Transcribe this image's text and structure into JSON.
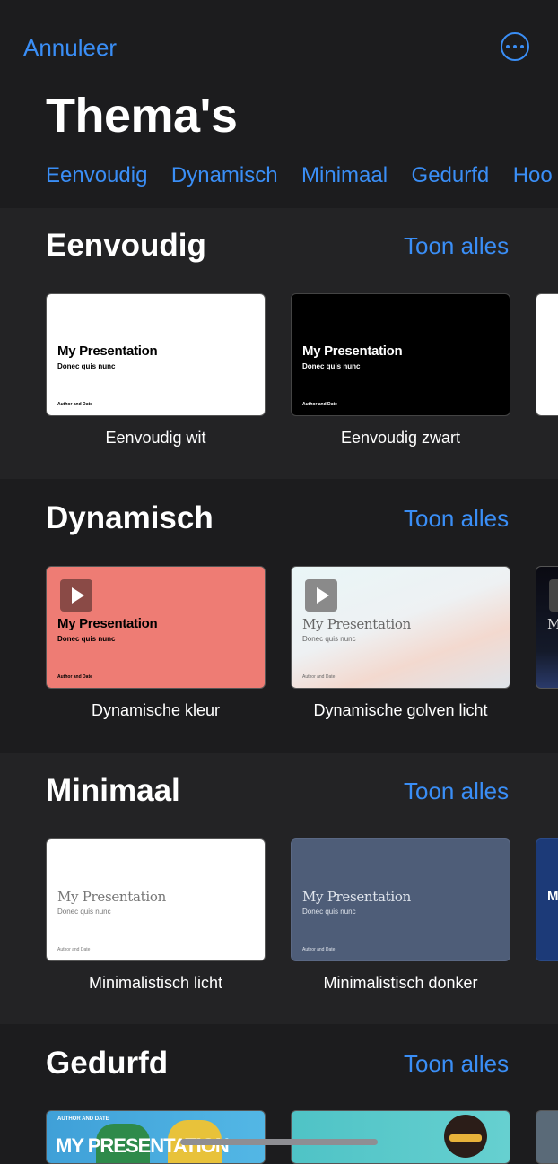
{
  "header": {
    "cancel_label": "Annuleer",
    "more_icon": "ellipsis-circle-icon"
  },
  "title": "Thema's",
  "tabs": [
    "Eenvoudig",
    "Dynamisch",
    "Minimaal",
    "Gedurfd",
    "Hoo"
  ],
  "sections": [
    {
      "title": "Eenvoudig",
      "show_all": "Toon alles",
      "themes": [
        {
          "name": "Eenvoudig wit",
          "slide_title": "My Presentation",
          "slide_subtitle": "Donec quis nunc",
          "slide_footer": "Author and Date"
        },
        {
          "name": "Eenvoudig zwart",
          "slide_title": "My Presentation",
          "slide_subtitle": "Donec quis nunc",
          "slide_footer": "Author and Date"
        }
      ]
    },
    {
      "title": "Dynamisch",
      "show_all": "Toon alles",
      "themes": [
        {
          "name": "Dynamische kleur",
          "slide_title": "My Presentation",
          "slide_subtitle": "Donec quis nunc",
          "slide_footer": "Author and Date"
        },
        {
          "name": "Dynamische golven licht",
          "slide_title": "My Presentation",
          "slide_subtitle": "Donec quis nunc",
          "slide_footer": "Author and Date"
        },
        {
          "slide_title": "M"
        }
      ]
    },
    {
      "title": "Minimaal",
      "show_all": "Toon alles",
      "themes": [
        {
          "name": "Minimalistisch licht",
          "slide_title": "My Presentation",
          "slide_subtitle": "Donec quis nunc",
          "slide_footer": "Author and Date"
        },
        {
          "name": "Minimalistisch donker",
          "slide_title": "My Presentation",
          "slide_subtitle": "Donec quis nunc",
          "slide_footer": "Author and Date"
        },
        {
          "slide_title": "M"
        }
      ]
    },
    {
      "title": "Gedurfd",
      "show_all": "Toon alles",
      "themes": [
        {
          "slide_title": "MY PRESENTATION",
          "slide_footer": "AUTHOR AND DATE"
        }
      ]
    }
  ],
  "colors": {
    "accent": "#3a8ef6",
    "background": "#1c1c1e",
    "dynamic_color_card": "#ee7c74",
    "minimal_dark_card": "#4e5d78"
  }
}
